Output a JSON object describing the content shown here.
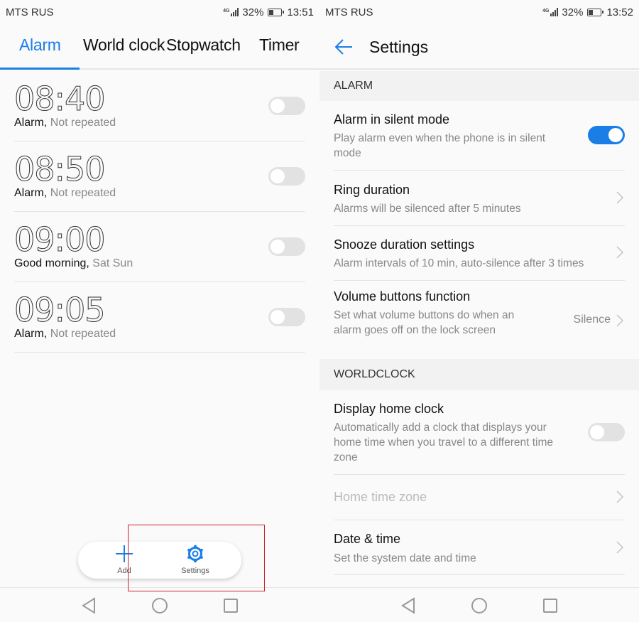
{
  "left": {
    "status": {
      "carrier": "MTS RUS",
      "network": "4G",
      "battery": "32%",
      "battery_level": 0.32,
      "time": "13:51"
    },
    "tabs": [
      {
        "label": "Alarm",
        "active": true
      },
      {
        "label": "World clock",
        "active": false
      },
      {
        "label": "Stopwatch",
        "active": false
      },
      {
        "label": "Timer",
        "active": false
      }
    ],
    "alarms": [
      {
        "time": "08:40",
        "name": "Alarm,",
        "repeat": "Not repeated",
        "enabled": false
      },
      {
        "time": "08:50",
        "name": "Alarm,",
        "repeat": "Not repeated",
        "enabled": false
      },
      {
        "time": "09:00",
        "name": "Good morning,",
        "repeat": "Sat Sun",
        "enabled": false
      },
      {
        "time": "09:05",
        "name": "Alarm,",
        "repeat": "Not repeated",
        "enabled": false
      }
    ],
    "actions": {
      "add_label": "Add",
      "settings_label": "Settings"
    }
  },
  "right": {
    "status": {
      "carrier": "MTS RUS",
      "network": "4G",
      "battery": "32%",
      "battery_level": 0.32,
      "time": "13:52"
    },
    "header": {
      "title": "Settings"
    },
    "sections": {
      "alarm": "ALARM",
      "worldclock": "WORLDCLOCK"
    },
    "items": {
      "silent": {
        "title": "Alarm in silent mode",
        "desc": "Play alarm even when the phone is in silent mode",
        "enabled": true
      },
      "ring": {
        "title": "Ring duration",
        "desc": "Alarms will be silenced after 5 minutes"
      },
      "snooze": {
        "title": "Snooze duration settings",
        "desc": "Alarm intervals of 10 min, auto-silence after 3 times"
      },
      "volume": {
        "title": "Volume buttons function",
        "desc": "Set what volume buttons do when an alarm goes off on the lock screen",
        "value": "Silence"
      },
      "home_clock": {
        "title": "Display home clock",
        "desc": "Automatically add a clock that displays your home time when you travel to a different time zone",
        "enabled": false
      },
      "home_zone": {
        "title": "Home time zone",
        "disabled": true
      },
      "datetime": {
        "title": "Date & time",
        "desc": "Set the system date and time"
      }
    }
  },
  "colors": {
    "accent": "#1a7ee6",
    "highlight": "#d0202a"
  }
}
